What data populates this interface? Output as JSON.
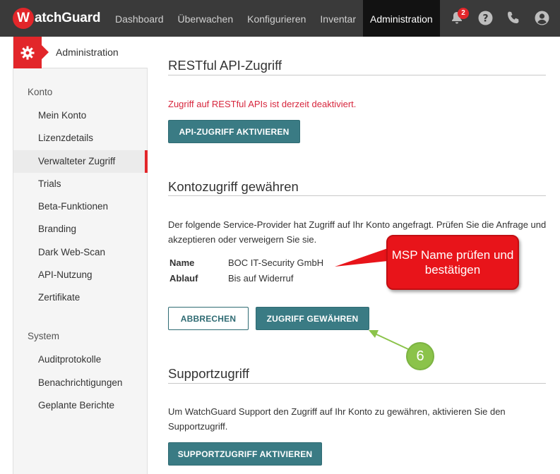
{
  "brand": {
    "logo_letter": "W",
    "logo_rest": "atchGuard"
  },
  "nav": {
    "items": [
      "Dashboard",
      "Überwachen",
      "Konfigurieren",
      "Inventar",
      "Administration"
    ],
    "active_index": 4,
    "notification_count": "2",
    "icons": [
      "bell-icon",
      "help-icon",
      "phone-icon",
      "user-icon"
    ]
  },
  "sidebar": {
    "header": "Administration",
    "sections": [
      {
        "label": "Konto",
        "items": [
          "Mein Konto",
          "Lizenzdetails",
          "Verwalteter Zugriff",
          "Trials",
          "Beta-Funktionen",
          "Branding",
          "Dark Web-Scan",
          "API-Nutzung",
          "Zertifikate"
        ]
      },
      {
        "label": "System",
        "items": [
          "Auditprotokolle",
          "Benachrichtigungen",
          "Geplante Berichte"
        ]
      }
    ],
    "active_item": "Verwalteter Zugriff"
  },
  "restful": {
    "title": "RESTful API-Zugriff",
    "status": "Zugriff auf RESTful APIs ist derzeit deaktiviert.",
    "button": "API-ZUGRIFF AKTIVIEREN"
  },
  "account_access": {
    "title": "Kontozugriff gewähren",
    "description": "Der folgende Service-Provider hat Zugriff auf Ihr Konto angefragt. Prüfen Sie die Anfrage und akzeptieren oder verweigern Sie sie.",
    "name_label": "Name",
    "name_value": "BOC IT-Security GmbH",
    "expiry_label": "Ablauf",
    "expiry_value": "Bis auf Widerruf",
    "cancel_button": "ABBRECHEN",
    "grant_button": "ZUGRIFF GEWÄHREN"
  },
  "support": {
    "title": "Supportzugriff",
    "description": "Um WatchGuard Support den Zugriff auf Ihr Konto zu gewähren, aktivieren Sie den Supportzugriff.",
    "button": "SUPPORTZUGRIFF AKTIVIEREN"
  },
  "annotation": {
    "callout": "MSP Name prüfen und bestätigen",
    "step": "6"
  },
  "colors": {
    "accent_red": "#e2262a",
    "teal": "#3a7b84",
    "topbar": "#3a3a3a",
    "step_green": "#8bc34a"
  }
}
